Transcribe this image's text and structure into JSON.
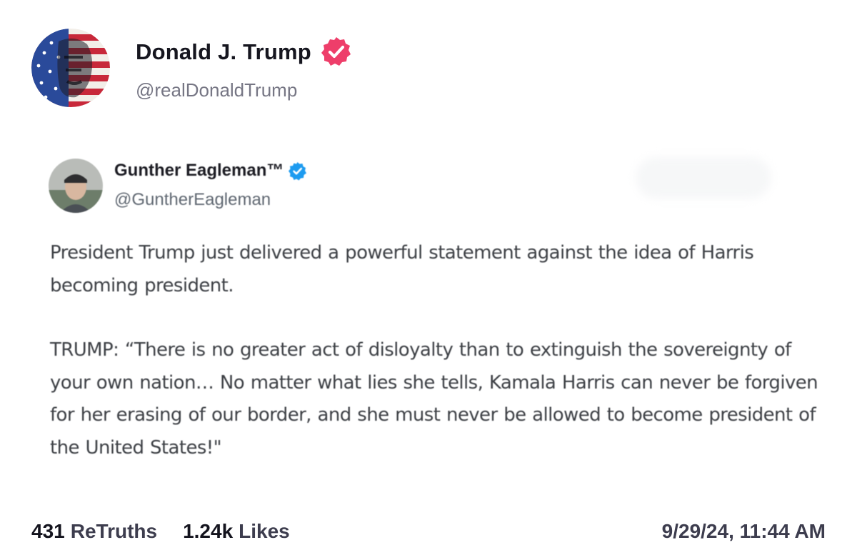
{
  "post": {
    "author": {
      "name": "Donald J. Trump",
      "handle": "@realDonaldTrump",
      "verified_icon": "verified-badge-icon",
      "verified_color": "#ee3e6a"
    },
    "quoted_post": {
      "author": {
        "name": "Gunther Eagleman™",
        "handle": "@GuntherEagleman",
        "verified_icon": "verified-badge-icon",
        "verified_color": "#1d9bf0"
      },
      "paragraphs": [
        "President Trump just delivered a powerful statement against the idea of Harris becoming president.",
        "TRUMP: “There is no greater act of disloyalty than to extinguish the sovereignty of your own nation… No matter what lies she tells, Kamala Harris can never be forgiven for her erasing of our border, and she must never be allowed to become president of the United States!\""
      ]
    },
    "stats": {
      "retruths_count": "431",
      "retruths_label": "ReTruths",
      "likes_count": "1.24k",
      "likes_label": "Likes"
    },
    "timestamp": "9/29/24, 11:44 AM"
  },
  "colors": {
    "flag_red": "#c8283a",
    "flag_blue": "#2a4a9a"
  }
}
